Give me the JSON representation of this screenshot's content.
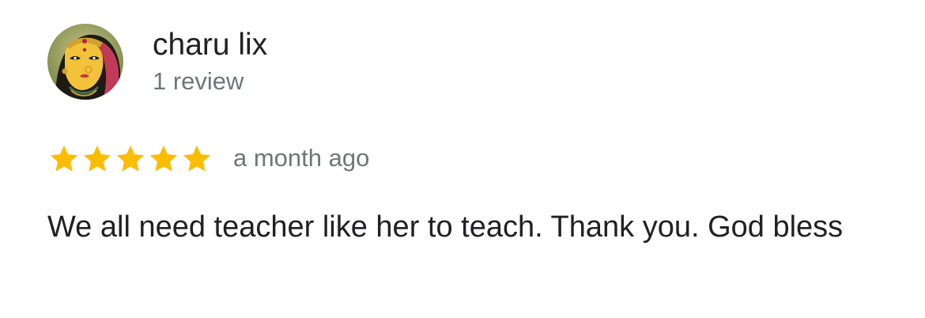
{
  "reviewer": {
    "name": "charu lix",
    "review_count": "1 review",
    "avatar_icon": "profile-photo"
  },
  "review": {
    "rating": 5,
    "rating_max": 5,
    "star_color": "#fbbc04",
    "date": "a month ago",
    "text": "We all need teacher like her to teach. Thank you. God bless"
  }
}
